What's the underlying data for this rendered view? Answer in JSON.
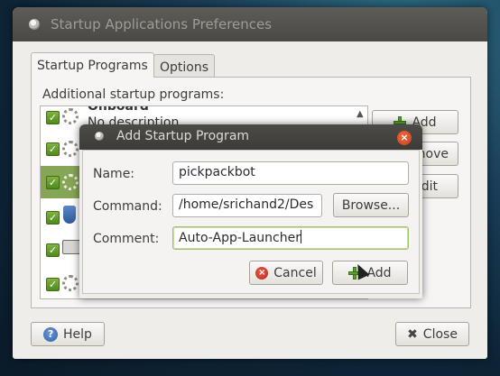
{
  "main_window": {
    "title": "Startup Applications Preferences",
    "tabs": [
      {
        "label": "Startup Programs",
        "active": true
      },
      {
        "label": "Options",
        "active": false
      }
    ],
    "section_label": "Additional startup programs:",
    "programs": [
      {
        "title": "Onboard",
        "description": "No description",
        "enabled": true,
        "icon": "gears-icon"
      },
      {
        "enabled": true,
        "icon": "gears-icon"
      },
      {
        "enabled": true,
        "icon": "gears-icon",
        "selected": true
      },
      {
        "enabled": true,
        "icon": "shield-icon"
      },
      {
        "enabled": true,
        "icon": "printer-icon"
      },
      {
        "enabled": true,
        "icon": "gears-icon"
      }
    ],
    "side_buttons": {
      "add": "Add",
      "remove": "move",
      "edit": "dit"
    },
    "help_button": "Help",
    "close_button": "Close"
  },
  "dialog": {
    "title": "Add Startup Program",
    "name_label": "Name:",
    "name_value": "pickpackbot",
    "command_label": "Command:",
    "command_value": "/home/srichand2/Des",
    "browse_button": "Browse...",
    "comment_label": "Comment:",
    "comment_value": "Auto-App-Launcher",
    "cancel_button": "Cancel",
    "add_button": "Add"
  },
  "colors": {
    "selection_green": "#87a556",
    "checkbox_green": "#5aa02c",
    "focus_green": "#9cc46a",
    "close_orange": "#e0542a"
  }
}
